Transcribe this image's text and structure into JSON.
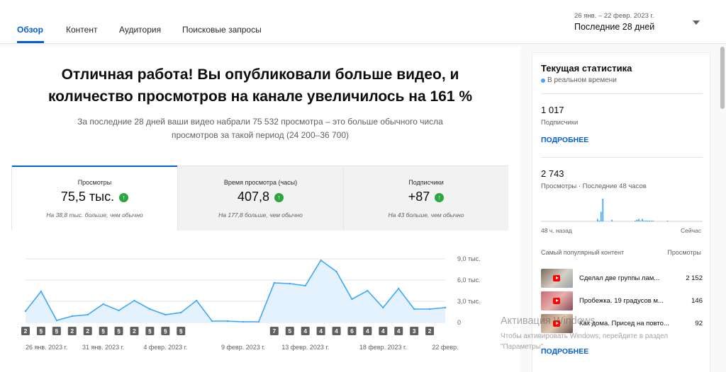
{
  "nav": {
    "tabs": [
      "Обзор",
      "Контент",
      "Аудитория",
      "Поисковые запросы"
    ],
    "active_tab": "Обзор",
    "date_range": "26 янв. – 22 февр. 2023 г.",
    "date_label": "Последние 28 дней"
  },
  "summary": {
    "headline": "Отличная работа! Вы опубликовали больше видео, и количество просмотров на канале увеличилось на 161 %",
    "subline": "За последние 28 дней ваши видео набрали 75 532 просмотра – это больше обычного числа просмотров за такой период (24 200–36 700)"
  },
  "metrics": [
    {
      "title": "Просмотры",
      "value": "75,5 тыс.",
      "note": "На 38,8 тыс. больше, чем обычно",
      "arrow": "↑"
    },
    {
      "title": "Время просмотра (часы)",
      "value": "407,8",
      "note": "На 177,8 больше, чем обычно",
      "arrow": "↑"
    },
    {
      "title": "Подписчики",
      "value": "+87",
      "note": "На 43 больше, чем обычно",
      "arrow": "↑"
    }
  ],
  "chart_data": {
    "type": "area",
    "title": "",
    "xlabel": "",
    "ylabel": "",
    "ylim": [
      0,
      9000
    ],
    "y_ticks": [
      "9,0 тыс.",
      "6,0 тыс.",
      "3,0 тыс.",
      "0"
    ],
    "y_tick_values": [
      9000,
      6000,
      3000,
      0
    ],
    "x_tick_labels": [
      "26 янв. 2023 г.",
      "31 янв. 2023 г.",
      "4 февр. 2023 г.",
      "9 февр. 2023 г.",
      "13 февр. 2023 г.",
      "18 февр. 2023 г.",
      "22 февр."
    ],
    "x_tick_index": [
      0,
      5,
      9,
      14,
      18,
      23,
      27
    ],
    "x": [
      "26 янв.",
      "27 янв.",
      "28 янв.",
      "29 янв.",
      "30 янв.",
      "31 янв.",
      "1 февр.",
      "2 февр.",
      "3 февр.",
      "4 февр.",
      "5 февр.",
      "6 февр.",
      "7 февр.",
      "8 февр.",
      "9 февр.",
      "10 февр.",
      "11 февр.",
      "12 февр.",
      "13 февр.",
      "14 февр.",
      "15 февр.",
      "16 февр.",
      "17 февр.",
      "18 февр.",
      "19 февр.",
      "20 февр.",
      "21 февр.",
      "22 февр."
    ],
    "values": [
      1600,
      4400,
      300,
      900,
      1100,
      2600,
      1700,
      3100,
      1900,
      1100,
      1400,
      3100,
      200,
      200,
      100,
      100,
      5600,
      5500,
      5200,
      8800,
      7200,
      3300,
      4500,
      2100,
      4800,
      1900,
      1900,
      2100
    ],
    "markers": [
      "2",
      "s",
      "s",
      "2",
      "2",
      "s",
      "s",
      "2",
      "s",
      "s",
      "s",
      "",
      "",
      "",
      "",
      "",
      "7",
      "5",
      "4",
      "4",
      "4",
      "6",
      "4",
      "4",
      "4",
      "3",
      "2",
      ""
    ],
    "series_color": "#3ea6ff",
    "fill_color": "#e3f2fd"
  },
  "realtime": {
    "title": "Текущая статистика",
    "live_label": "В реальном времени",
    "subscribers": "1 017",
    "subscribers_label": "Подписчики",
    "more_label_1": "ПОДРОБНЕЕ",
    "views": "2 743",
    "views_label": "Просмотры · Последние 48 часов",
    "axis_left": "48 ч. назад",
    "axis_right": "Сейчас",
    "popular_head": "Самый популярный контент",
    "popular_head_right": "Просмотры",
    "popular": [
      {
        "title": "Сделал две группы лам...",
        "count": "2 152"
      },
      {
        "title": "Пробежка. 19 градусов м...",
        "count": "146"
      },
      {
        "title": "Как дома. Присед на повто...",
        "count": "92"
      }
    ],
    "more_label_2": "ПОДРОБНЕЕ",
    "mini_bars": [
      0,
      0,
      0,
      0,
      0,
      0,
      0,
      0,
      0,
      0,
      0,
      0,
      0,
      0,
      0,
      0,
      0,
      0,
      0,
      0,
      0,
      0,
      0,
      0,
      0,
      0,
      0,
      0,
      0,
      0,
      0,
      3,
      1,
      12,
      28,
      0,
      0,
      0,
      0,
      2,
      0,
      0,
      0,
      0,
      0,
      0,
      0,
      0,
      0,
      0,
      0,
      0,
      1,
      2,
      3,
      1,
      3,
      1,
      1,
      1,
      1,
      1,
      1,
      0,
      0,
      0,
      0,
      0,
      0,
      0,
      1,
      0,
      0,
      0,
      0,
      0,
      0,
      0,
      0,
      0,
      0,
      0,
      0,
      0,
      0,
      0,
      0,
      0,
      0,
      0
    ],
    "accent": "#3ea6ff"
  },
  "watermark": {
    "line1": "Активация Windows",
    "line2": "Чтобы активировать Windows, перейдите в раздел \"Параметры\"."
  }
}
